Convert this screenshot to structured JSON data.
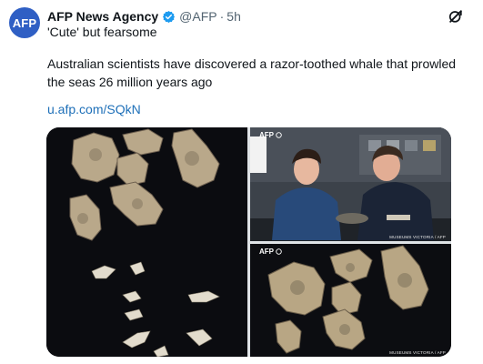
{
  "tweet": {
    "avatar_text": "AFP",
    "author": "AFP News Agency",
    "handle": "@AFP",
    "separator": "·",
    "time": "5h",
    "subtitle": "'Cute' but fearsome",
    "body": "Australian scientists have discovered a razor-toothed whale that prowled the seas 26 million years ago",
    "link": "u.afp.com/SQkN"
  },
  "media": {
    "top_right": {
      "tag": "AFP",
      "credit": "MUSEUMS VICTORIA / AFP"
    },
    "bottom_right": {
      "tag": "AFP",
      "credit": "MUSEUMS VICTORIA / AFP"
    }
  },
  "icons": {
    "verified": "verified-badge-icon",
    "grok": "grok-icon"
  },
  "colors": {
    "brand_blue": "#2f5fc4",
    "verified_blue": "#1d9bf0",
    "link": "#1d6fb8",
    "muted": "#536471"
  }
}
